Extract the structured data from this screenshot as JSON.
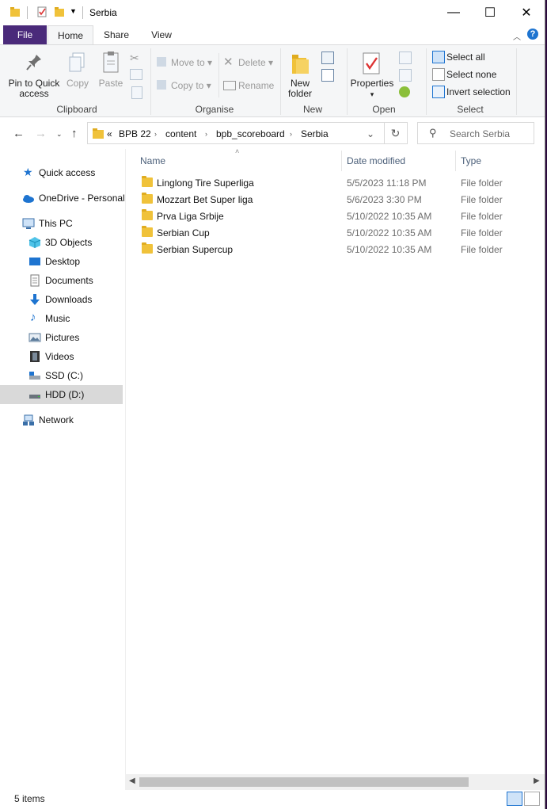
{
  "window": {
    "title": "Serbia",
    "minimize_glyph": "—",
    "maximize_glyph": "☐",
    "close_glyph": "✕"
  },
  "ribbon_tabs": [
    "File",
    "Home",
    "Share",
    "View"
  ],
  "ribbon": {
    "clipboard": {
      "pin_label_1": "Pin to Quick",
      "pin_label_2": "access",
      "copy": "Copy",
      "paste": "Paste",
      "group": "Clipboard"
    },
    "organise": {
      "move_to": "Move to",
      "copy_to": "Copy to",
      "delete": "Delete",
      "rename": "Rename",
      "group": "Organise"
    },
    "new": {
      "new_folder_1": "New",
      "new_folder_2": "folder",
      "group": "New"
    },
    "open": {
      "properties": "Properties",
      "group": "Open"
    },
    "select": {
      "select_all": "Select all",
      "select_none": "Select none",
      "invert": "Invert selection",
      "group": "Select"
    }
  },
  "address": {
    "overflow": "«",
    "crumbs": [
      "BPB 22",
      "content",
      "bpb_scoreboard",
      "Serbia"
    ],
    "search_placeholder": "Search Serbia"
  },
  "sidebar": {
    "items": [
      {
        "label": "Quick access",
        "icon": "star-icon"
      },
      {
        "label": "OneDrive - Personal",
        "icon": "cloud-icon"
      },
      {
        "label": "This PC",
        "icon": "monitor-icon"
      },
      {
        "label": "3D Objects",
        "icon": "cube-icon"
      },
      {
        "label": "Desktop",
        "icon": "desktop-icon"
      },
      {
        "label": "Documents",
        "icon": "document-icon"
      },
      {
        "label": "Downloads",
        "icon": "download-icon"
      },
      {
        "label": "Music",
        "icon": "music-icon"
      },
      {
        "label": "Pictures",
        "icon": "picture-icon"
      },
      {
        "label": "Videos",
        "icon": "video-icon"
      },
      {
        "label": "SSD (C:)",
        "icon": "drive-icon"
      },
      {
        "label": "HDD (D:)",
        "icon": "drive-icon"
      },
      {
        "label": "Network",
        "icon": "network-icon"
      }
    ]
  },
  "columns": {
    "name": "Name",
    "date": "Date modified",
    "type": "Type"
  },
  "files": [
    {
      "name": "Linglong Tire Superliga",
      "date": "5/5/2023 11:18 PM",
      "type": "File folder"
    },
    {
      "name": "Mozzart Bet Super liga",
      "date": "5/6/2023 3:30 PM",
      "type": "File folder"
    },
    {
      "name": "Prva Liga Srbije",
      "date": "5/10/2022 10:35 AM",
      "type": "File folder"
    },
    {
      "name": "Serbian Cup",
      "date": "5/10/2022 10:35 AM",
      "type": "File folder"
    },
    {
      "name": "Serbian Supercup",
      "date": "5/10/2022 10:35 AM",
      "type": "File folder"
    }
  ],
  "status": {
    "count": "5 items"
  },
  "colors": {
    "file_tab": "#4a2a7a",
    "accent": "#1e74d0",
    "folder": "#f0c23a"
  }
}
